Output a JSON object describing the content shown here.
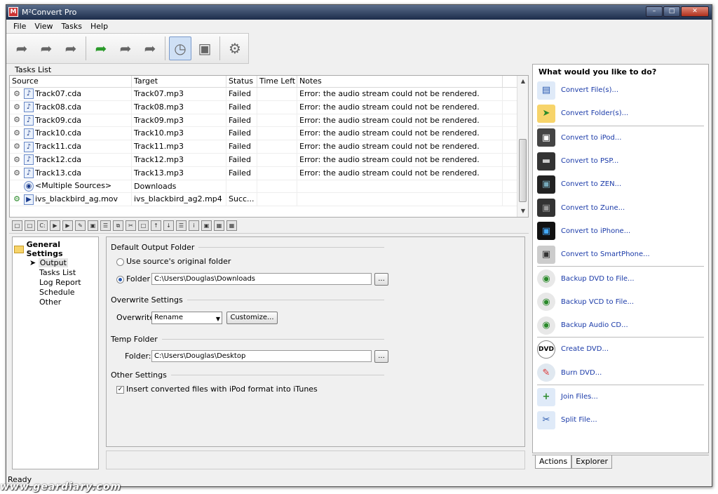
{
  "app": {
    "title": "M²Convert Pro",
    "icon_label": "M"
  },
  "menu": [
    "File",
    "View",
    "Tasks",
    "Help"
  ],
  "tasks": {
    "label": "Tasks List",
    "columns": [
      "Source",
      "Target",
      "Status",
      "Time Left",
      "Notes"
    ],
    "rows": [
      {
        "source": "Track07.cda",
        "target": "Track07.mp3",
        "status": "Failed",
        "time": "",
        "notes": "Error: the audio stream could not be rendered."
      },
      {
        "source": "Track08.cda",
        "target": "Track08.mp3",
        "status": "Failed",
        "time": "",
        "notes": "Error: the audio stream could not be rendered."
      },
      {
        "source": "Track09.cda",
        "target": "Track09.mp3",
        "status": "Failed",
        "time": "",
        "notes": "Error: the audio stream could not be rendered."
      },
      {
        "source": "Track10.cda",
        "target": "Track10.mp3",
        "status": "Failed",
        "time": "",
        "notes": "Error: the audio stream could not be rendered."
      },
      {
        "source": "Track11.cda",
        "target": "Track11.mp3",
        "status": "Failed",
        "time": "",
        "notes": "Error: the audio stream could not be rendered."
      },
      {
        "source": "Track12.cda",
        "target": "Track12.mp3",
        "status": "Failed",
        "time": "",
        "notes": "Error: the audio stream could not be rendered."
      },
      {
        "source": "Track13.cda",
        "target": "Track13.mp3",
        "status": "Failed",
        "time": "",
        "notes": "Error: the audio stream could not be rendered."
      },
      {
        "source": "<Multiple Sources>",
        "target": "Downloads",
        "status": "",
        "time": "",
        "notes": ""
      },
      {
        "source": "ivs_blackbird_ag.mov",
        "target": "ivs_blackbird_ag2.mp4",
        "status": "Succ...",
        "time": "",
        "notes": ""
      }
    ]
  },
  "tree": {
    "root": "General Settings",
    "items": [
      "Output",
      "Tasks List",
      "Log Report",
      "Schedule",
      "Other"
    ]
  },
  "settings": {
    "default_output_folder": "Default Output Folder",
    "use_source_original": "Use source's original folder",
    "folder_label": "Folder",
    "folder_path": "C:\\Users\\Douglas\\Downloads",
    "browse": "...",
    "overwrite_settings": "Overwrite Settings",
    "overwrite_label": "Overwrite:",
    "overwrite_value": "Rename",
    "customize": "Customize...",
    "temp_folder": "Temp Folder",
    "temp_folder_label": "Folder:",
    "temp_path": "C:\\Users\\Douglas\\Desktop",
    "other_settings": "Other Settings",
    "itunes_option": "Insert converted files with iPod format into iTunes"
  },
  "actions": {
    "title": "What would you like to do?",
    "items": [
      "Convert File(s)...",
      "Convert Folder(s)...",
      "Convert to iPod...",
      "Convert to PSP...",
      "Convert to ZEN...",
      "Convert to Zune...",
      "Convert to iPhone...",
      "Convert to SmartPhone...",
      "Backup DVD to File...",
      "Backup VCD to File...",
      "Backup Audio CD...",
      "Create DVD...",
      "Burn DVD...",
      "Join Files...",
      "Split File..."
    ],
    "tabs": [
      "Actions",
      "Explorer"
    ],
    "dvd_badge": "DVD"
  },
  "status": {
    "text": "Ready",
    "watermark": "www.geardiary.com"
  }
}
